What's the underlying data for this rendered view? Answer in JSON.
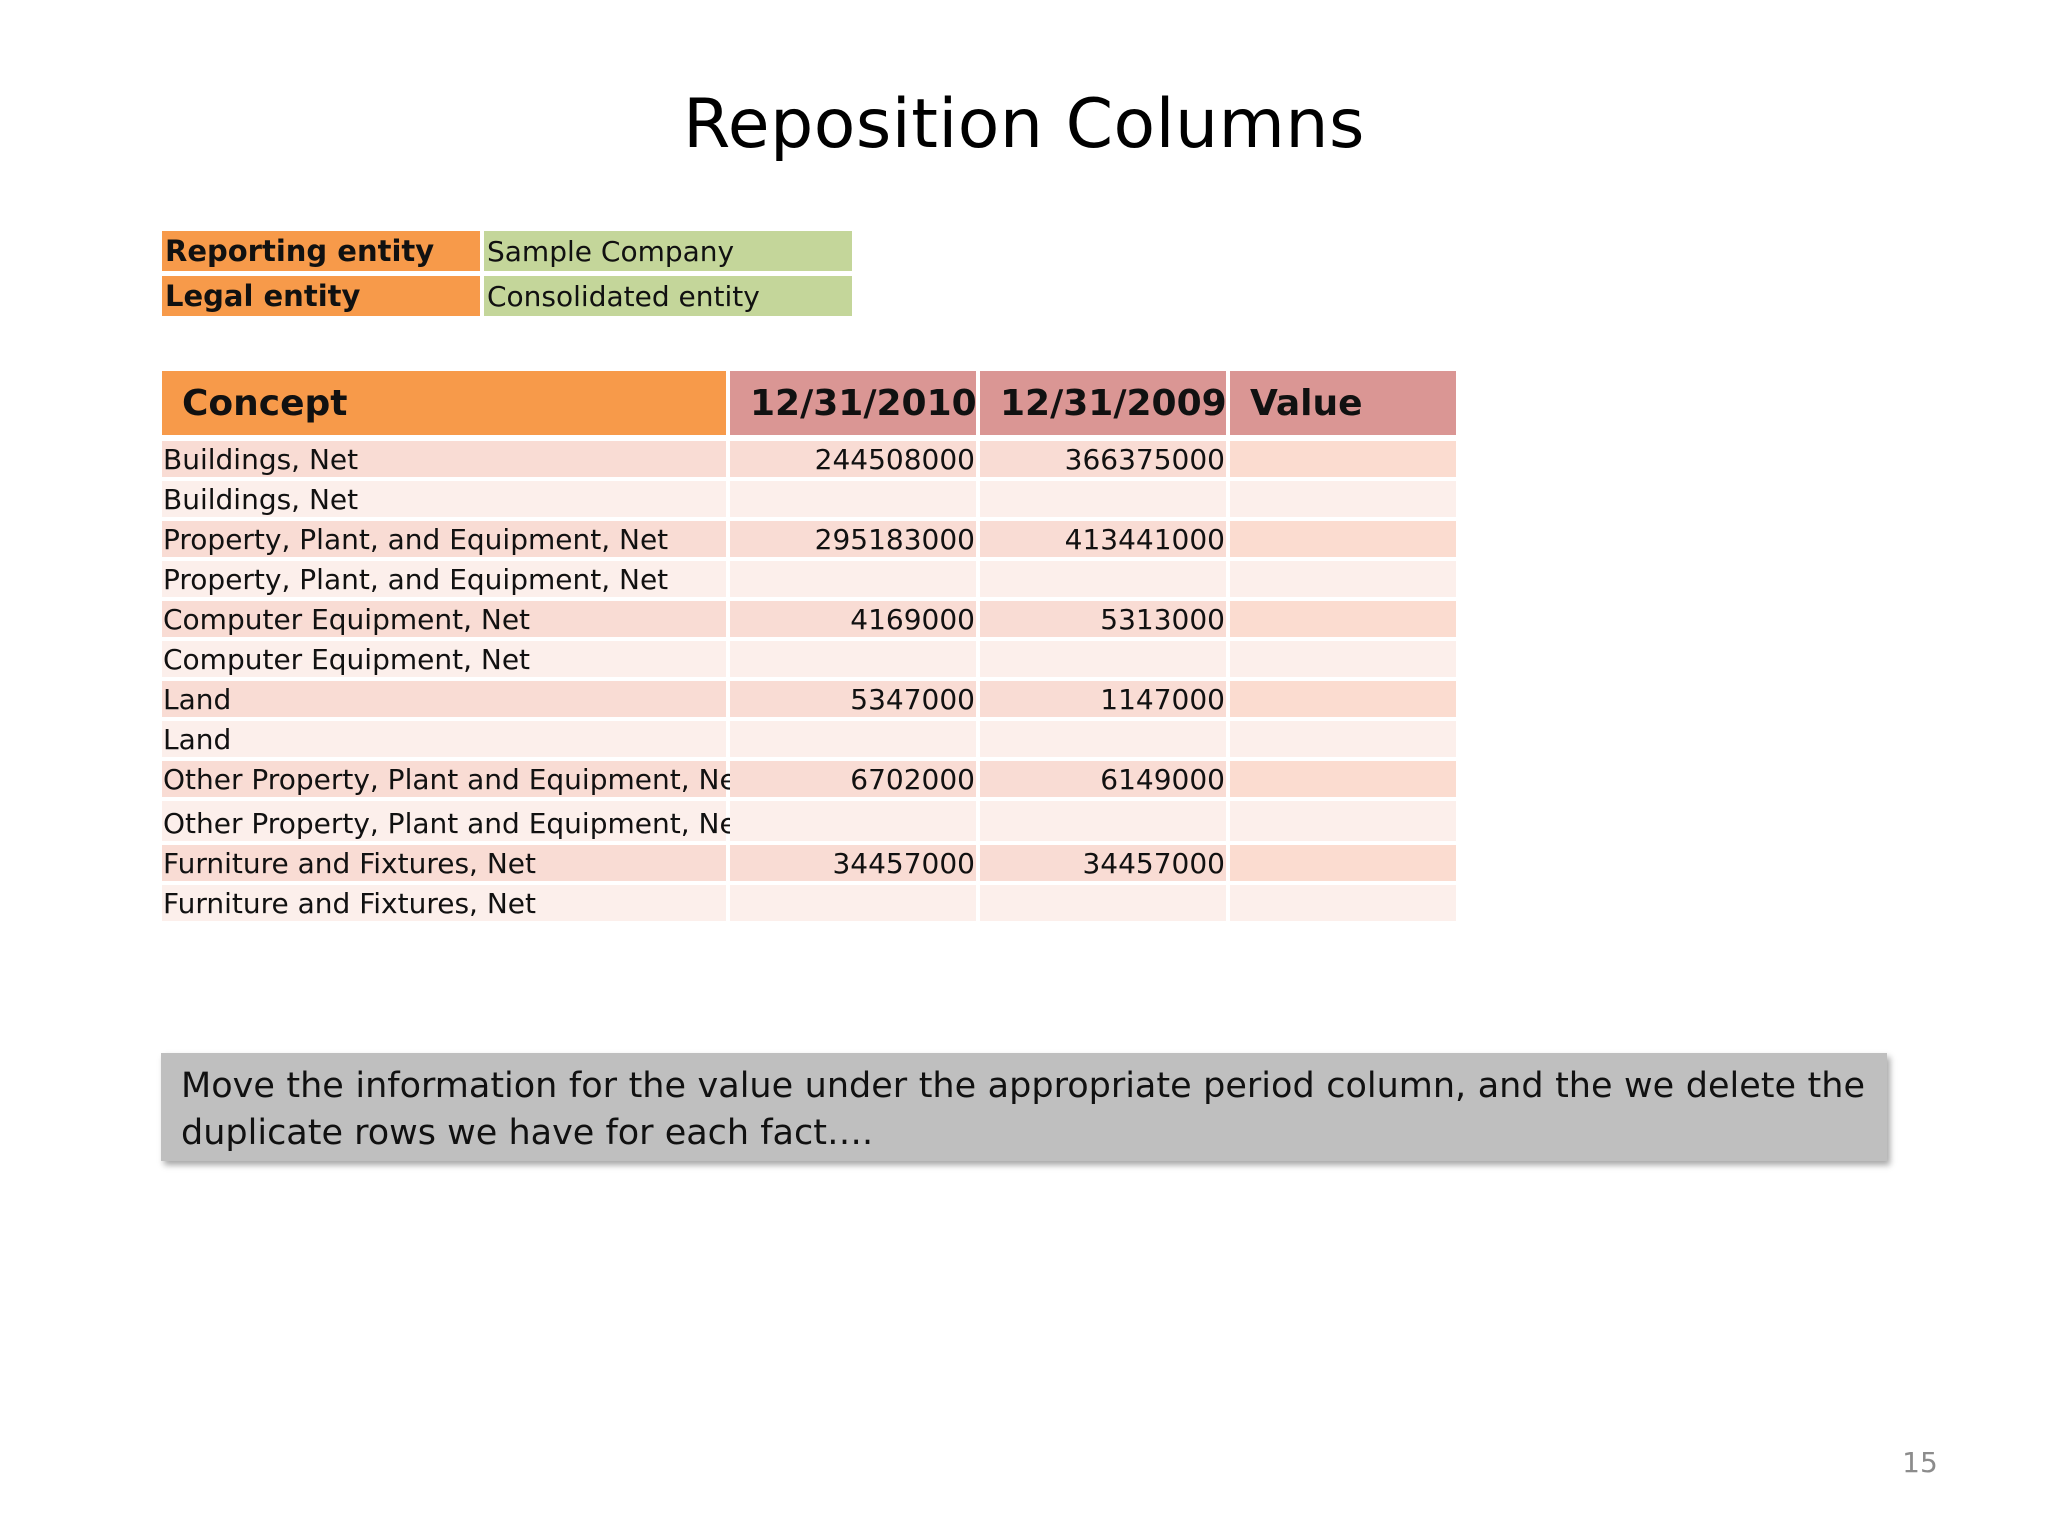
{
  "slide": {
    "title": "Reposition Columns",
    "page_number": "15"
  },
  "entity_info": {
    "rows": [
      {
        "label": "Reporting entity",
        "value": "Sample Company"
      },
      {
        "label": "Legal entity",
        "value": "Consolidated entity"
      }
    ]
  },
  "data_table": {
    "headers": {
      "concept": "Concept",
      "period_1": "12/31/2010",
      "period_2": "12/31/2009",
      "value": "Value"
    },
    "rows": [
      {
        "concept": "Buildings, Net",
        "p2010": "244508000",
        "p2009": "366375000",
        "value": ""
      },
      {
        "concept": "Buildings, Net",
        "p2010": "",
        "p2009": "",
        "value": ""
      },
      {
        "concept": "Property, Plant, and Equipment, Net",
        "p2010": "295183000",
        "p2009": "413441000",
        "value": ""
      },
      {
        "concept": "Property, Plant, and Equipment, Net",
        "p2010": "",
        "p2009": "",
        "value": ""
      },
      {
        "concept": "Computer Equipment, Net",
        "p2010": "4169000",
        "p2009": "5313000",
        "value": ""
      },
      {
        "concept": "Computer Equipment, Net",
        "p2010": "",
        "p2009": "",
        "value": ""
      },
      {
        "concept": "Land",
        "p2010": "5347000",
        "p2009": "1147000",
        "value": ""
      },
      {
        "concept": "Land",
        "p2010": "",
        "p2009": "",
        "value": ""
      },
      {
        "concept": "Other Property, Plant and Equipment, Net",
        "p2010": "6702000",
        "p2009": "6149000",
        "value": ""
      },
      {
        "concept": "Other Property, Plant and Equipment, Net",
        "p2010": "",
        "p2009": "",
        "value": ""
      },
      {
        "concept": "Furniture and Fixtures, Net",
        "p2010": "34457000",
        "p2009": "34457000",
        "value": ""
      },
      {
        "concept": "Furniture and Fixtures, Net",
        "p2010": "",
        "p2009": "",
        "value": ""
      }
    ]
  },
  "note": {
    "text": "Move the information for the value under the appropriate period column, and the we delete the duplicate rows we have for each fact…."
  },
  "colors": {
    "orange_header": "#f79a4a",
    "rose_header": "#da9694",
    "green_value": "#c4d69a",
    "row_shade_dark": "#f9dcd4",
    "row_shade_light": "#fcefeb",
    "note_background": "#bfbfbf"
  }
}
